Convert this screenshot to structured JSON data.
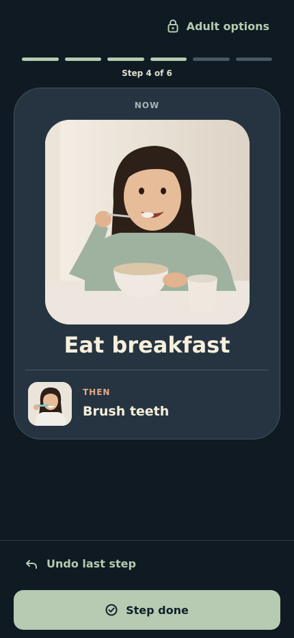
{
  "header": {
    "adult_options_label": "Adult options",
    "adult_options_icon": "lock-icon"
  },
  "progress": {
    "current_step": 4,
    "total_steps": 6,
    "label": "Step 4 of 6",
    "done_color": "#b6cbb1",
    "pending_color": "#4a5661"
  },
  "current_task": {
    "badge": "NOW",
    "title": "Eat breakfast",
    "image": "child-eating-cereal-photo"
  },
  "next_task": {
    "badge": "THEN",
    "title": "Brush teeth",
    "image": "child-brushing-teeth-photo"
  },
  "actions": {
    "undo_label": "Undo last step",
    "undo_icon": "undo-icon",
    "done_label": "Step done",
    "done_icon": "check-circle-icon"
  },
  "colors": {
    "background": "#0f1a22",
    "card": "#253440",
    "accent": "#b6cbb1",
    "then_accent": "#e3a888"
  }
}
